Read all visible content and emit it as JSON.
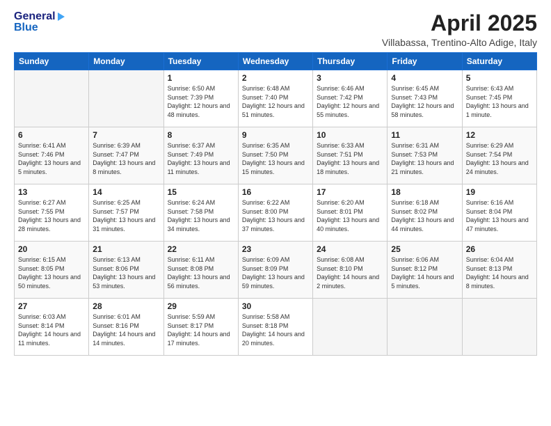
{
  "header": {
    "logo_general": "General",
    "logo_blue": "Blue",
    "month_title": "April 2025",
    "subtitle": "Villabassa, Trentino-Alto Adige, Italy"
  },
  "days_of_week": [
    "Sunday",
    "Monday",
    "Tuesday",
    "Wednesday",
    "Thursday",
    "Friday",
    "Saturday"
  ],
  "weeks": [
    [
      {
        "day": "",
        "info": ""
      },
      {
        "day": "",
        "info": ""
      },
      {
        "day": "1",
        "info": "Sunrise: 6:50 AM\nSunset: 7:39 PM\nDaylight: 12 hours and 48 minutes."
      },
      {
        "day": "2",
        "info": "Sunrise: 6:48 AM\nSunset: 7:40 PM\nDaylight: 12 hours and 51 minutes."
      },
      {
        "day": "3",
        "info": "Sunrise: 6:46 AM\nSunset: 7:42 PM\nDaylight: 12 hours and 55 minutes."
      },
      {
        "day": "4",
        "info": "Sunrise: 6:45 AM\nSunset: 7:43 PM\nDaylight: 12 hours and 58 minutes."
      },
      {
        "day": "5",
        "info": "Sunrise: 6:43 AM\nSunset: 7:45 PM\nDaylight: 13 hours and 1 minute."
      }
    ],
    [
      {
        "day": "6",
        "info": "Sunrise: 6:41 AM\nSunset: 7:46 PM\nDaylight: 13 hours and 5 minutes."
      },
      {
        "day": "7",
        "info": "Sunrise: 6:39 AM\nSunset: 7:47 PM\nDaylight: 13 hours and 8 minutes."
      },
      {
        "day": "8",
        "info": "Sunrise: 6:37 AM\nSunset: 7:49 PM\nDaylight: 13 hours and 11 minutes."
      },
      {
        "day": "9",
        "info": "Sunrise: 6:35 AM\nSunset: 7:50 PM\nDaylight: 13 hours and 15 minutes."
      },
      {
        "day": "10",
        "info": "Sunrise: 6:33 AM\nSunset: 7:51 PM\nDaylight: 13 hours and 18 minutes."
      },
      {
        "day": "11",
        "info": "Sunrise: 6:31 AM\nSunset: 7:53 PM\nDaylight: 13 hours and 21 minutes."
      },
      {
        "day": "12",
        "info": "Sunrise: 6:29 AM\nSunset: 7:54 PM\nDaylight: 13 hours and 24 minutes."
      }
    ],
    [
      {
        "day": "13",
        "info": "Sunrise: 6:27 AM\nSunset: 7:55 PM\nDaylight: 13 hours and 28 minutes."
      },
      {
        "day": "14",
        "info": "Sunrise: 6:25 AM\nSunset: 7:57 PM\nDaylight: 13 hours and 31 minutes."
      },
      {
        "day": "15",
        "info": "Sunrise: 6:24 AM\nSunset: 7:58 PM\nDaylight: 13 hours and 34 minutes."
      },
      {
        "day": "16",
        "info": "Sunrise: 6:22 AM\nSunset: 8:00 PM\nDaylight: 13 hours and 37 minutes."
      },
      {
        "day": "17",
        "info": "Sunrise: 6:20 AM\nSunset: 8:01 PM\nDaylight: 13 hours and 40 minutes."
      },
      {
        "day": "18",
        "info": "Sunrise: 6:18 AM\nSunset: 8:02 PM\nDaylight: 13 hours and 44 minutes."
      },
      {
        "day": "19",
        "info": "Sunrise: 6:16 AM\nSunset: 8:04 PM\nDaylight: 13 hours and 47 minutes."
      }
    ],
    [
      {
        "day": "20",
        "info": "Sunrise: 6:15 AM\nSunset: 8:05 PM\nDaylight: 13 hours and 50 minutes."
      },
      {
        "day": "21",
        "info": "Sunrise: 6:13 AM\nSunset: 8:06 PM\nDaylight: 13 hours and 53 minutes."
      },
      {
        "day": "22",
        "info": "Sunrise: 6:11 AM\nSunset: 8:08 PM\nDaylight: 13 hours and 56 minutes."
      },
      {
        "day": "23",
        "info": "Sunrise: 6:09 AM\nSunset: 8:09 PM\nDaylight: 13 hours and 59 minutes."
      },
      {
        "day": "24",
        "info": "Sunrise: 6:08 AM\nSunset: 8:10 PM\nDaylight: 14 hours and 2 minutes."
      },
      {
        "day": "25",
        "info": "Sunrise: 6:06 AM\nSunset: 8:12 PM\nDaylight: 14 hours and 5 minutes."
      },
      {
        "day": "26",
        "info": "Sunrise: 6:04 AM\nSunset: 8:13 PM\nDaylight: 14 hours and 8 minutes."
      }
    ],
    [
      {
        "day": "27",
        "info": "Sunrise: 6:03 AM\nSunset: 8:14 PM\nDaylight: 14 hours and 11 minutes."
      },
      {
        "day": "28",
        "info": "Sunrise: 6:01 AM\nSunset: 8:16 PM\nDaylight: 14 hours and 14 minutes."
      },
      {
        "day": "29",
        "info": "Sunrise: 5:59 AM\nSunset: 8:17 PM\nDaylight: 14 hours and 17 minutes."
      },
      {
        "day": "30",
        "info": "Sunrise: 5:58 AM\nSunset: 8:18 PM\nDaylight: 14 hours and 20 minutes."
      },
      {
        "day": "",
        "info": ""
      },
      {
        "day": "",
        "info": ""
      },
      {
        "day": "",
        "info": ""
      }
    ]
  ]
}
